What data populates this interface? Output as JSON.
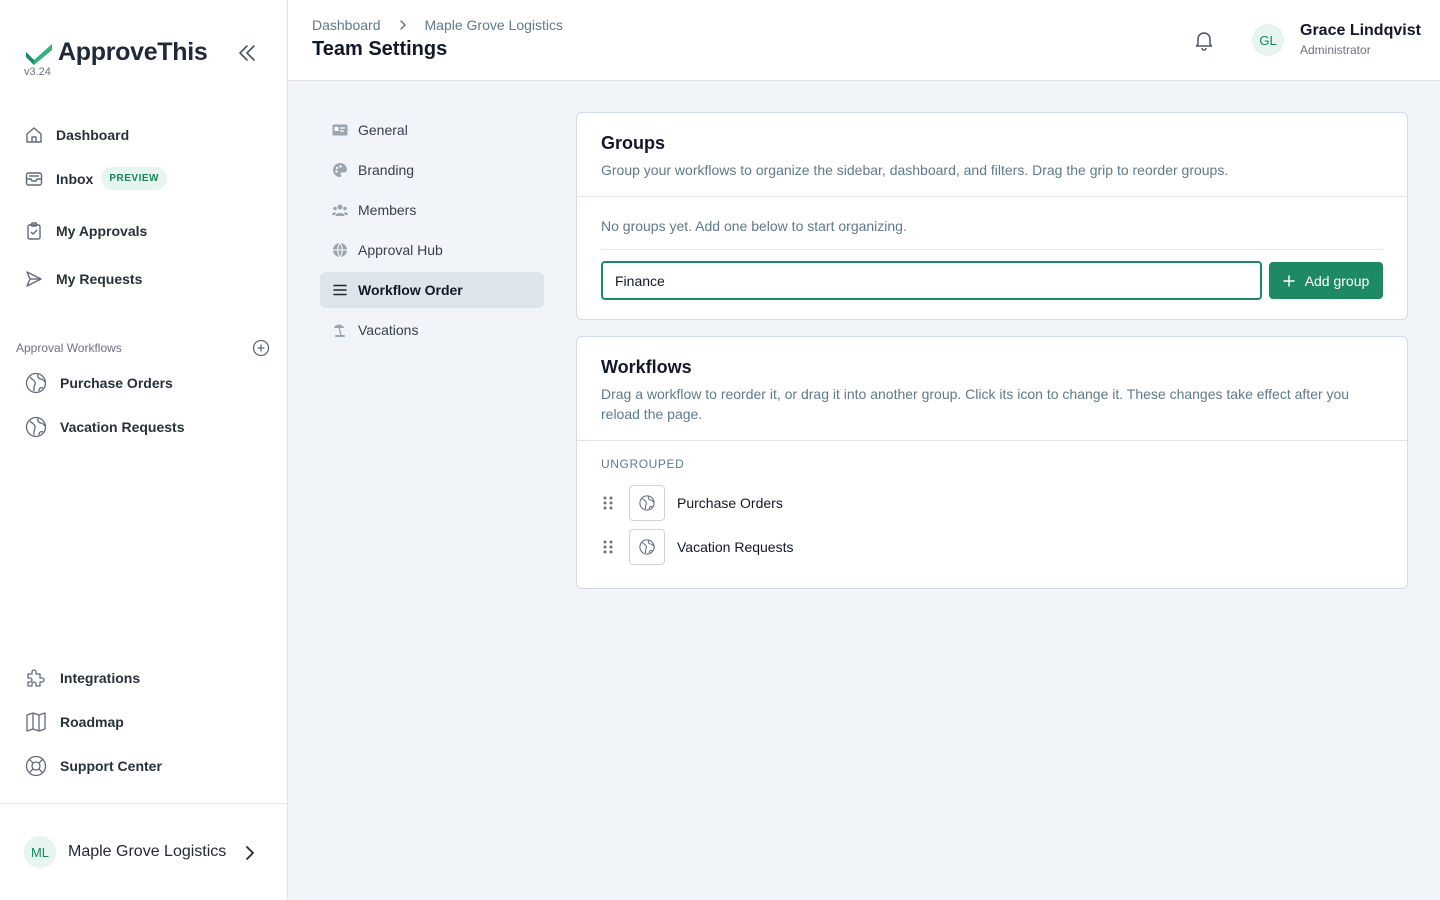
{
  "brand": {
    "name": "ApproveThis",
    "version": "v3.24",
    "accent": "#1e8a63"
  },
  "sidebar": {
    "nav": [
      {
        "label": "Dashboard",
        "icon": "home-icon"
      },
      {
        "label": "Inbox",
        "icon": "inbox-icon",
        "badge": "PREVIEW"
      },
      {
        "label": "My Approvals",
        "icon": "clipboard-icon"
      },
      {
        "label": "My Requests",
        "icon": "send-icon"
      }
    ],
    "workflows_label": "Approval Workflows",
    "workflows": [
      {
        "label": "Purchase Orders",
        "icon": "globe-icon"
      },
      {
        "label": "Vacation Requests",
        "icon": "globe-icon"
      }
    ],
    "bottom": [
      {
        "label": "Integrations",
        "icon": "puzzle-icon"
      },
      {
        "label": "Roadmap",
        "icon": "map-icon"
      },
      {
        "label": "Support Center",
        "icon": "lifebuoy-icon"
      }
    ],
    "org": {
      "initials": "ML",
      "name": "Maple Grove Logistics"
    }
  },
  "header": {
    "breadcrumb": [
      "Dashboard",
      "Maple Grove Logistics"
    ],
    "title": "Team Settings",
    "user": {
      "initials": "GL",
      "name": "Grace Lindqvist",
      "role": "Administrator"
    }
  },
  "settings_nav": [
    {
      "label": "General",
      "icon": "id-card-icon"
    },
    {
      "label": "Branding",
      "icon": "palette-icon"
    },
    {
      "label": "Members",
      "icon": "users-icon"
    },
    {
      "label": "Approval Hub",
      "icon": "globe-icon"
    },
    {
      "label": "Workflow Order",
      "icon": "list-icon",
      "active": true
    },
    {
      "label": "Vacations",
      "icon": "umbrella-icon"
    }
  ],
  "groups": {
    "title": "Groups",
    "description": "Group your workflows to organize the sidebar, dashboard, and filters. Drag the grip to reorder groups.",
    "empty": "No groups yet. Add one below to start organizing.",
    "input_value": "Finance",
    "add_label": "Add group"
  },
  "workflows_card": {
    "title": "Workflows",
    "description": "Drag a workflow to reorder it, or drag it into another group. Click its icon to change it. These changes take effect after you reload the page.",
    "ungrouped_label": "UNGROUPED",
    "items": [
      "Purchase Orders",
      "Vacation Requests"
    ]
  }
}
